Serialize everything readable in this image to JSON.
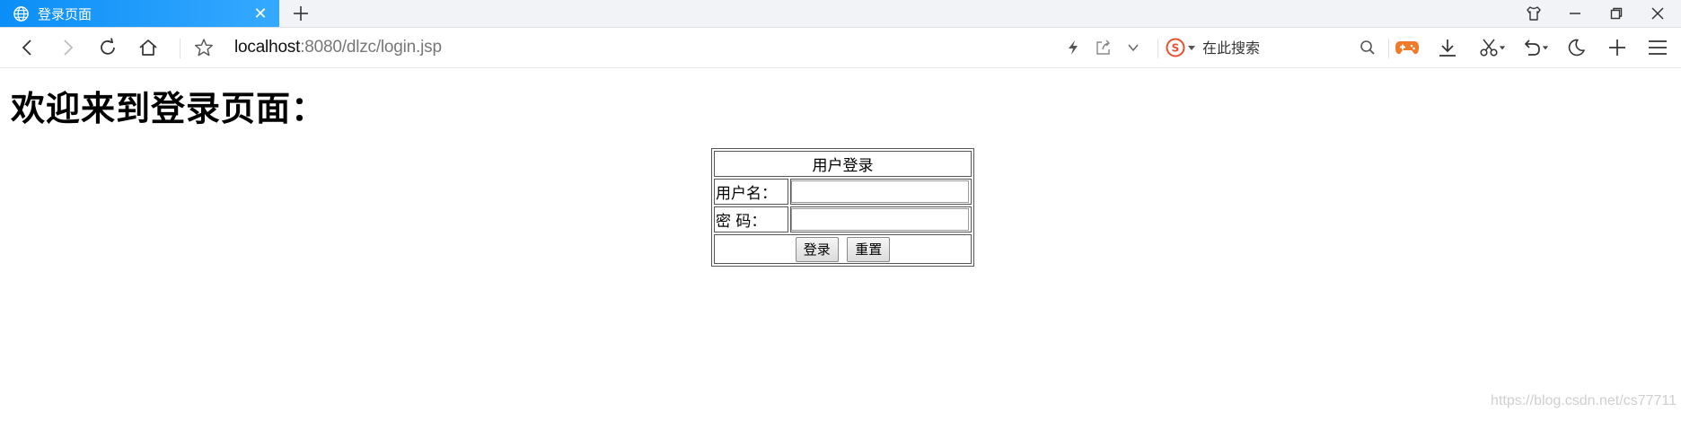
{
  "browser": {
    "tab": {
      "title": "登录页面",
      "close_glyph": "✕"
    },
    "new_tab_glyph": "+",
    "address_bar": {
      "host": "localhost",
      "rest": ":8080/dlzc/login.jsp"
    },
    "search": {
      "engine_icon": "sogou-icon",
      "placeholder": "在此搜索"
    },
    "window_controls": [
      "skin-icon",
      "minimize-icon",
      "restore-icon",
      "close-icon"
    ]
  },
  "page": {
    "heading": "欢迎来到登录页面：",
    "form": {
      "caption": "用户登录",
      "username_label": "用户名：",
      "username_value": "",
      "password_label": "密 码：",
      "password_value": "",
      "login_button": "登录",
      "reset_button": "重置"
    }
  },
  "watermark": "https://blog.csdn.net/cs77711",
  "colors": {
    "tab_active": "#0b8ef7",
    "game_icon": "#f07a28",
    "sogou": "#e8502e"
  }
}
